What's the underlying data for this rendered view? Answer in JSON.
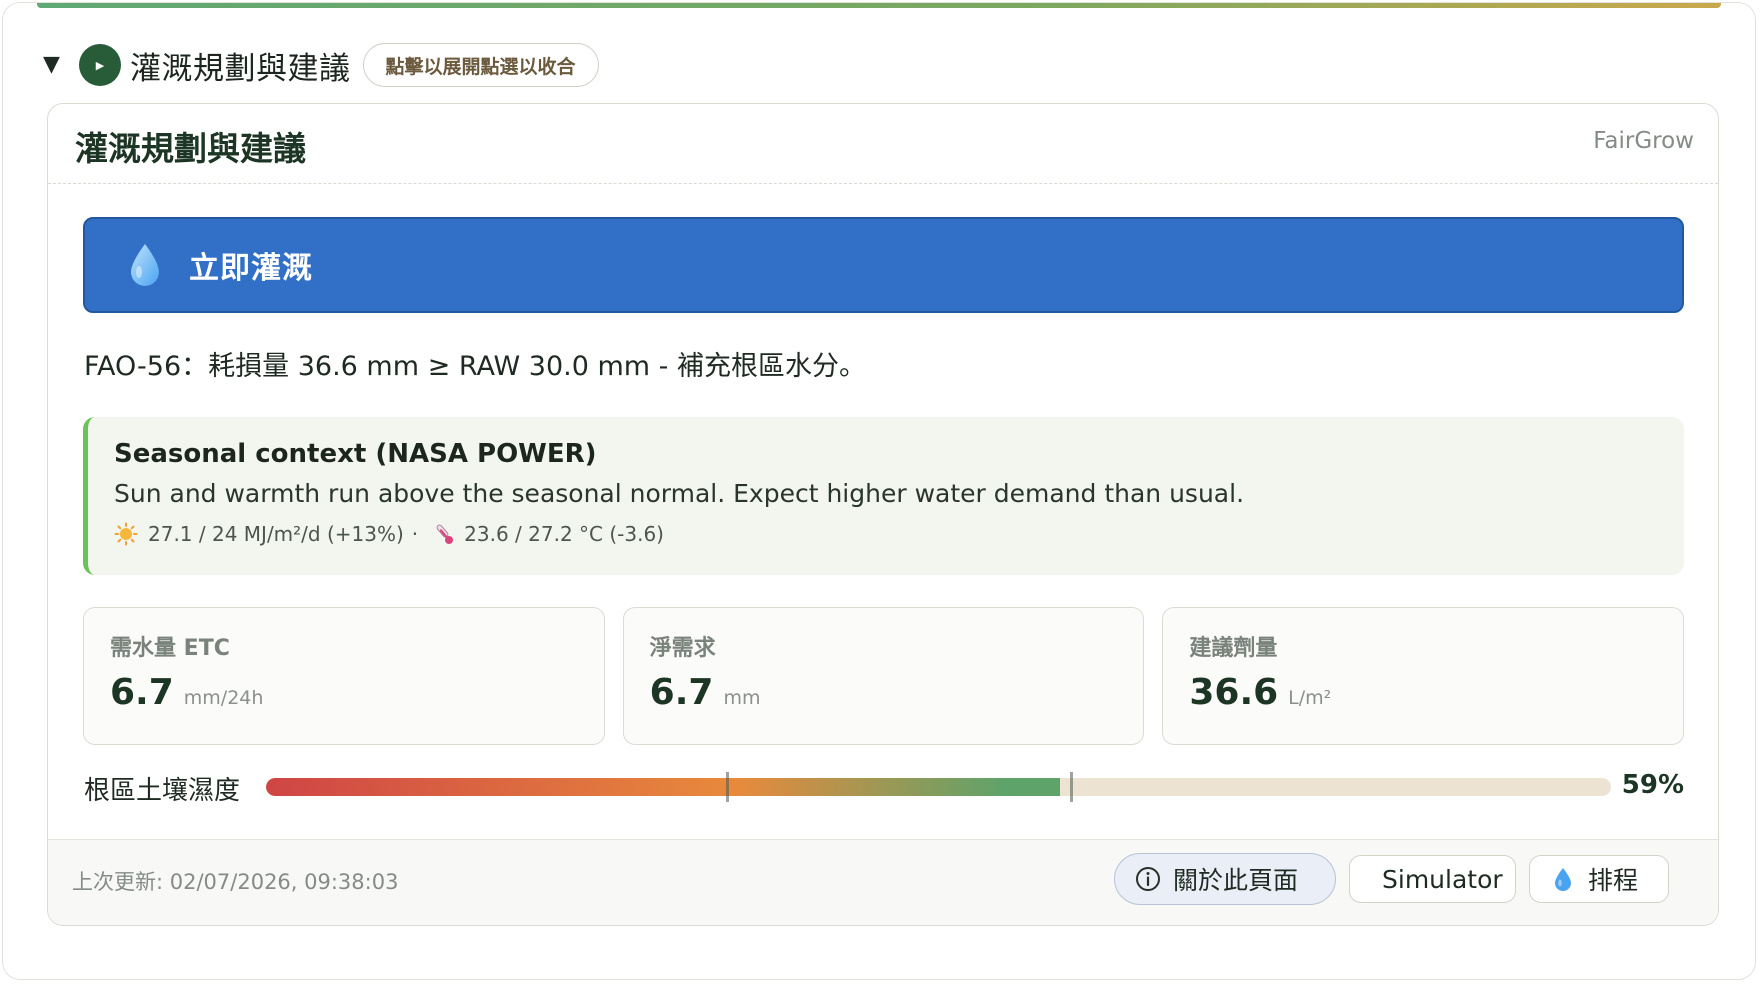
{
  "summary": {
    "title": "灌溉規劃與建議",
    "hint": "點擊以展開點選以收合"
  },
  "card": {
    "title": "灌溉規劃與建議",
    "brand": "FairGrow"
  },
  "banner": {
    "icon": "water-drop-icon",
    "text": "立即灌溉"
  },
  "reason": "FAO-56：耗損量 36.6 mm ≥ RAW 30.0 mm - 補充根區水分。",
  "seasonal": {
    "title": "Seasonal context (NASA POWER)",
    "description": "Sun and warmth run above the seasonal normal. Expect higher water demand than usual.",
    "radiation": "27.1 / 24 MJ/m²/d (+13%)",
    "separator": "·",
    "temperature": "23.6 / 27.2 °C (-3.6)"
  },
  "stats": [
    {
      "label": "需水量 ETC",
      "value": "6.7",
      "unit": "mm/24h"
    },
    {
      "label": "淨需求",
      "value": "6.7",
      "unit": "mm"
    },
    {
      "label": "建議劑量",
      "value": "36.6",
      "unit": "L/m²"
    }
  ],
  "soil": {
    "label": "根區土壤濕度",
    "percent_text": "59%",
    "value": 0.59
  },
  "footer": {
    "updated": "上次更新: 02/07/2026, 09:38:03",
    "about_label": "關於此頁面",
    "simulator_label": "Simulator",
    "schedule_label": "排程"
  },
  "colors": {
    "accent_green": "#285c39",
    "banner_blue": "#3170c6",
    "seasonal_border": "#6cc25a"
  }
}
